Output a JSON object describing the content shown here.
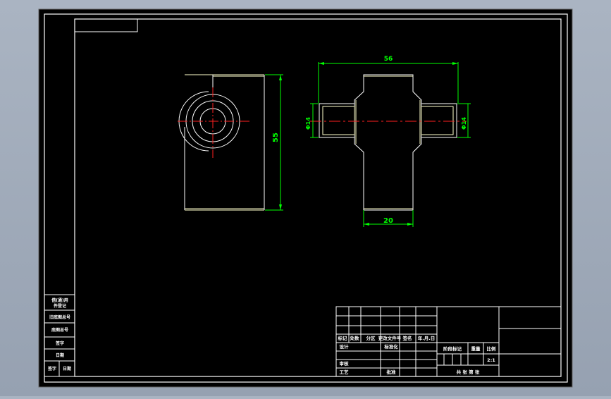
{
  "drawing": {
    "dimensions": {
      "height_left": "55",
      "width_top": "56",
      "width_bottom": "20",
      "diameter_left": "Φ14",
      "diameter_right": "Φ14"
    }
  },
  "side_stamp": {
    "rows": [
      "借(通)用",
      "件登记",
      "旧底图总号",
      "底图总号",
      "签字",
      "日期"
    ],
    "bottom_row": [
      "签字",
      "日期"
    ]
  },
  "title_block": {
    "row_labels": [
      "标记",
      "处数",
      "分区",
      "更改文件号",
      "签名",
      "年.月.日"
    ],
    "design": "设计",
    "standardize": "标准化",
    "audit": "审核",
    "process": "工艺",
    "approve": "批准",
    "stage_label": "阶段标记",
    "weight_label": "重量",
    "scale_label": "比例",
    "scale_value": "2:1",
    "sheet_info": "共  张  第  张"
  },
  "colors": {
    "background": "#000000",
    "frame": "#ffffff",
    "dimension": "#00ff00",
    "centerline": "#ff0000",
    "edge": "#ffffcc",
    "text": "#ffffff"
  }
}
